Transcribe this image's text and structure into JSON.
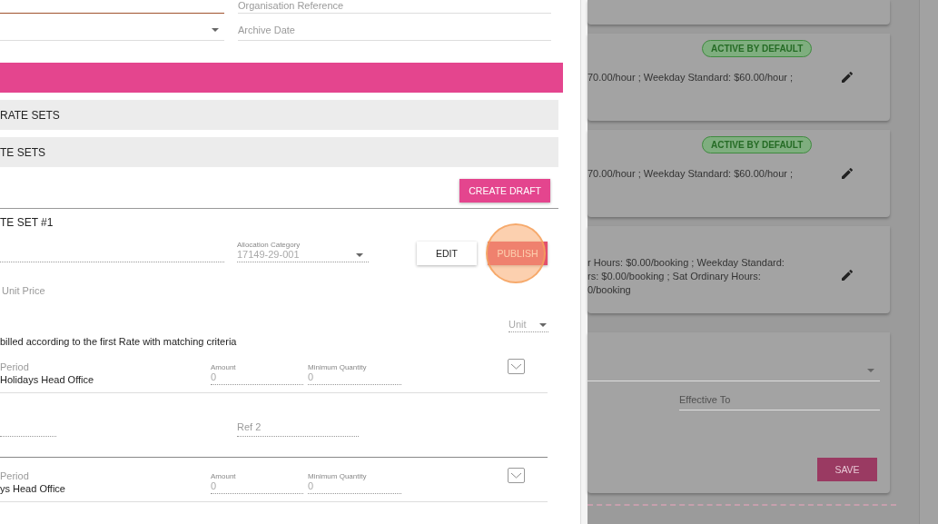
{
  "top_fields": [
    {
      "label": "Organisation Reference"
    },
    {
      "label": "Archive Date"
    }
  ],
  "accordions": [
    {
      "label": "RATE SETS"
    },
    {
      "label": "TE SETS"
    }
  ],
  "create_draft_button": "CREATE DRAFT",
  "rate_set": {
    "title": "TE SET #1",
    "allocation_category": {
      "label": "Allocation Category",
      "value": "17149-29-001"
    },
    "edit_button": "EDIT",
    "publish_button": "PUBLISH",
    "unit_price_label": "Unit Price",
    "unit_select": "Unit",
    "note": "billed according to the first Rate with matching criteria",
    "rates": [
      {
        "period_label": "Period",
        "period_value": "Holidays Head Office",
        "amount_label": "Amount",
        "amount": "0",
        "min_qty_label": "Minimum Quantity",
        "min_qty": "0",
        "ref_2_label": "Ref 2"
      },
      {
        "period_label": "Period",
        "period_value": "ys Head Office",
        "amount_label": "Amount",
        "amount": "0",
        "min_qty_label": "Minimum Quantity",
        "min_qty": "0"
      }
    ]
  },
  "rate_cards": [
    {
      "badge": "ACTIVE BY DEFAULT",
      "lines": [
        "70.00/hour ; Weekday Standard: $60.00/hour ;"
      ]
    },
    {
      "badge": "ACTIVE BY DEFAULT",
      "lines": [
        "70.00/hour ; Weekday Standard: $60.00/hour ;"
      ]
    },
    {
      "lines": [
        "r Hours: $0.00/booking ; Weekday Standard:",
        "rs: $0.00/booking ; Sat Ordinary Hours:",
        "0/booking"
      ]
    }
  ],
  "edit_form": {
    "effective_to_label": "Effective To",
    "save_button": "SAVE"
  }
}
